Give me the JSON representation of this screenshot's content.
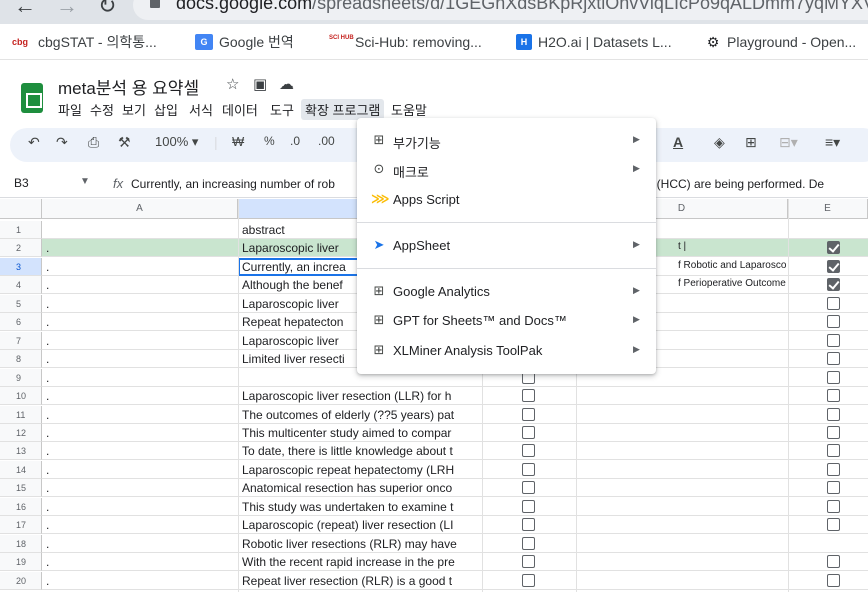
{
  "browser": {
    "url_main": "docs.google.com",
    "url_path": "/spreadsheets/d/1GEGhXdsBKpRjxtlOhvViqLIcPo9qALDmm7yqMYXVrz4"
  },
  "bookmarks": [
    {
      "icon": "cbg",
      "label": "cbgSTAT - 의학통..."
    },
    {
      "icon": "G",
      "label": "Google 번역"
    },
    {
      "icon": "SCI HUB",
      "label": "Sci-Hub: removing..."
    },
    {
      "icon": "H",
      "label": "H2O.ai | Datasets L..."
    },
    {
      "icon": "⚙",
      "label": "Playground - Open..."
    }
  ],
  "doc": {
    "title": "meta분석 용 요약셀",
    "menus": [
      "파일",
      "수정",
      "보기",
      "삽입",
      "서식",
      "데이터",
      "도구",
      "확장 프로그램",
      "도움말"
    ]
  },
  "toolbar": {
    "zoom": "100%",
    "currency": "₩",
    "percent": "%",
    "dec_less": ".0",
    "dec_more": ".00"
  },
  "formula": {
    "cell_ref": "B3",
    "text_left": "Currently, an increasing number of rob",
    "text_right": "oma (HCC) are being performed. De"
  },
  "columns": [
    "A",
    "D",
    "E"
  ],
  "rows": [
    {
      "num": "1",
      "a": "",
      "b": "abstract",
      "d": "",
      "check": "none"
    },
    {
      "num": "2",
      "a": ".",
      "b": "Laparoscopic liver",
      "d": "t |",
      "check": "on"
    },
    {
      "num": "3",
      "a": ".",
      "b": "Currently, an increa",
      "d": "f Robotic and Laparosco",
      "check": "on"
    },
    {
      "num": "4",
      "a": ".",
      "b": "Although the benef",
      "d": "f Perioperative Outcome",
      "check": "on"
    },
    {
      "num": "5",
      "a": ".",
      "b": "Laparoscopic liver",
      "d": "",
      "check": "off"
    },
    {
      "num": "6",
      "a": ".",
      "b": "Repeat hepatecton",
      "d": "",
      "check": "off"
    },
    {
      "num": "7",
      "a": ".",
      "b": "Laparoscopic liver",
      "d": "",
      "check": "off"
    },
    {
      "num": "8",
      "a": ".",
      "b": "Limited liver resecti",
      "d": "",
      "check": "off"
    },
    {
      "num": "9",
      "a": ".",
      "b": "",
      "d": "",
      "check": "off"
    },
    {
      "num": "10",
      "a": ".",
      "b": "Laparoscopic liver resection (LLR) for h",
      "d": "",
      "check": "off"
    },
    {
      "num": "11",
      "a": ".",
      "b": "The outcomes of elderly (??5 years) pat",
      "d": "",
      "check": "off"
    },
    {
      "num": "12",
      "a": ".",
      "b": "This multicenter study aimed to compar",
      "d": "",
      "check": "off"
    },
    {
      "num": "13",
      "a": ".",
      "b": "To date, there is little knowledge about t",
      "d": "",
      "check": "off"
    },
    {
      "num": "14",
      "a": ".",
      "b": "Laparoscopic repeat hepatectomy (LRH",
      "d": "",
      "check": "off"
    },
    {
      "num": "15",
      "a": ".",
      "b": "Anatomical resection has superior onco",
      "d": "",
      "check": "off"
    },
    {
      "num": "16",
      "a": ".",
      "b": "This study was undertaken to examine t",
      "d": "",
      "check": "off"
    },
    {
      "num": "17",
      "a": ".",
      "b": "Laparoscopic (repeat) liver resection (LI",
      "d": "",
      "check": "off"
    },
    {
      "num": "18",
      "a": ".",
      "b": "Robotic liver resections (RLR) may have",
      "d": "",
      "check": "none"
    },
    {
      "num": "19",
      "a": ".",
      "b": "With the recent rapid increase in the pre",
      "d": "",
      "check": "off"
    },
    {
      "num": "20",
      "a": ".",
      "b": "Repeat liver resection (RLR) is a good t",
      "d": "",
      "check": "off"
    }
  ],
  "extensions_menu": [
    {
      "label": "부가기능",
      "icon": "addon-icon",
      "submenu": true
    },
    {
      "label": "매크로",
      "icon": "macro-icon",
      "submenu": true
    },
    {
      "label": "Apps Script",
      "icon": "apps-script-icon",
      "submenu": false
    },
    {
      "label": "AppSheet",
      "icon": "appsheet-icon",
      "submenu": true
    },
    {
      "label": "Google Analytics",
      "icon": "addon-icon",
      "submenu": true
    },
    {
      "label": "GPT for Sheets™ and Docs™",
      "icon": "addon-icon",
      "submenu": true
    },
    {
      "label": "XLMiner Analysis ToolPak",
      "icon": "addon-icon",
      "submenu": true
    }
  ]
}
